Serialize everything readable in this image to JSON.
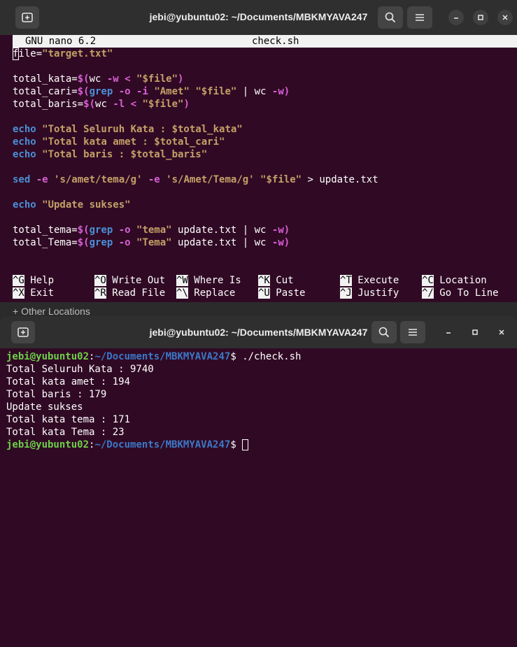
{
  "nano_window": {
    "title": "jebi@yubuntu02: ~/Documents/MBKMYAVA247",
    "header_left": "GNU nano 6.2",
    "header_file": "check.sh",
    "code": {
      "l1_var": "file=",
      "l1_val": "\"target.txt\"",
      "l2_a": "total_kata=",
      "l2_b": "$(",
      "l2_c": "wc ",
      "l2_d": "-w",
      "l2_e": " < ",
      "l2_f": "\"$file\"",
      "l2_g": ")",
      "l3_a": "total_cari=",
      "l3_b": "$(",
      "l3_c": "grep",
      "l3_d": " -o -i ",
      "l3_e": "\"Amet\"",
      "l3_f": " ",
      "l3_g": "\"$file\"",
      "l3_h": " | wc ",
      "l3_i": "-w",
      "l3_j": ")",
      "l4_a": "total_baris=",
      "l4_b": "$(",
      "l4_c": "wc ",
      "l4_d": "-l",
      "l4_e": " < ",
      "l4_f": "\"$file\"",
      "l4_g": ")",
      "echo": "echo",
      "e1": " \"Total Seluruh Kata : $total_kata\"",
      "e2": " \"Total kata amet : $total_cari\"",
      "e3": " \"Total baris : $total_baris\"",
      "sed": "sed",
      "sed_e1": " -e ",
      "sed_s1": "'s/amet/tema/g'",
      "sed_e2": " -e ",
      "sed_s2": "'s/Amet/Tema/g'",
      "sed_sp": " ",
      "sed_f": "\"$file\"",
      "sed_out": " > update.txt",
      "e4": " \"Update sukses\"",
      "t1_a": "total_tema=",
      "t1_b": "$(",
      "t1_c": "grep",
      "t1_d": " -o ",
      "t1_e": "\"tema\"",
      "t1_f": " update.txt | wc ",
      "t1_g": "-w",
      "t1_h": ")",
      "t2_a": "total_Tema=",
      "t2_b": "$(",
      "t2_c": "grep",
      "t2_d": " -o ",
      "t2_e": "\"Tema\"",
      "t2_f": " update.txt | wc ",
      "t2_g": "-w",
      "t2_h": ")"
    },
    "shortcuts": [
      {
        "key": "^G",
        "label": " Help"
      },
      {
        "key": "^O",
        "label": " Write Out"
      },
      {
        "key": "^W",
        "label": " Where Is"
      },
      {
        "key": "^K",
        "label": " Cut"
      },
      {
        "key": "^T",
        "label": " Execute"
      },
      {
        "key": "^C",
        "label": " Location"
      },
      {
        "key": "^X",
        "label": " Exit"
      },
      {
        "key": "^R",
        "label": " Read File"
      },
      {
        "key": "^\\",
        "label": " Replace"
      },
      {
        "key": "^U",
        "label": " Paste"
      },
      {
        "key": "^J",
        "label": " Justify"
      },
      {
        "key": "^/",
        "label": " Go To Line"
      }
    ]
  },
  "other_locations": "+ Other Locations",
  "terminal_window": {
    "title": "jebi@yubuntu02: ~/Documents/MBKMYAVA247",
    "prompt_user": "jebi@yubuntu02",
    "prompt_colon": ":",
    "prompt_path": "~/Documents/MBKMYAVA247",
    "prompt_dollar": "$ ",
    "command": "./check.sh",
    "output": [
      "Total Seluruh Kata : 9740",
      "Total kata amet : 194",
      "Total baris : 179",
      "Update sukses",
      "Total kata tema : 171",
      "Total kata Tema : 23"
    ]
  },
  "icons": {
    "new_tab": "new-tab-icon",
    "search": "search-icon",
    "menu": "hamburger-menu-icon",
    "minimize": "minimize-icon",
    "maximize": "maximize-icon",
    "close": "close-icon"
  }
}
